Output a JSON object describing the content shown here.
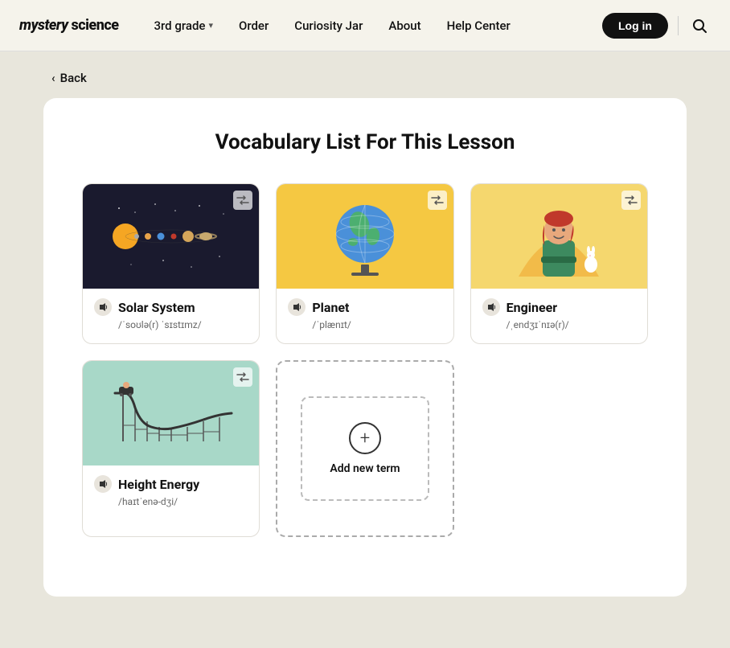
{
  "nav": {
    "logo": "mystery science",
    "grade_menu": "3rd grade",
    "links": [
      {
        "id": "order",
        "label": "Order"
      },
      {
        "id": "curiosity-jar",
        "label": "Curiosity Jar"
      },
      {
        "id": "about",
        "label": "About"
      },
      {
        "id": "help-center",
        "label": "Help Center"
      }
    ],
    "login_label": "Log in"
  },
  "back_label": "Back",
  "page_title": "Vocabulary List For This Lesson",
  "vocab_cards": [
    {
      "id": "solar-system",
      "word": "Solar System",
      "phonetic": "/ˈsoʊlə(r) ˈsɪstɪmz/",
      "image_type": "solar-bg"
    },
    {
      "id": "planet",
      "word": "Planet",
      "phonetic": "/ˈplænɪt/",
      "image_type": "planet-bg"
    },
    {
      "id": "engineer",
      "word": "Engineer",
      "phonetic": "/ˌendʒɪˈnɪə(r)/",
      "image_type": "engineer-bg"
    },
    {
      "id": "height-energy",
      "word": "Height Energy",
      "phonetic": "/haɪtˈenə-dʒi/",
      "image_type": "energy-bg"
    }
  ],
  "add_term_label": "Add new term",
  "icons": {
    "shuffle": "⇄",
    "sound": "🔊",
    "plus": "+",
    "search": "🔍",
    "back_arrow": "‹"
  }
}
